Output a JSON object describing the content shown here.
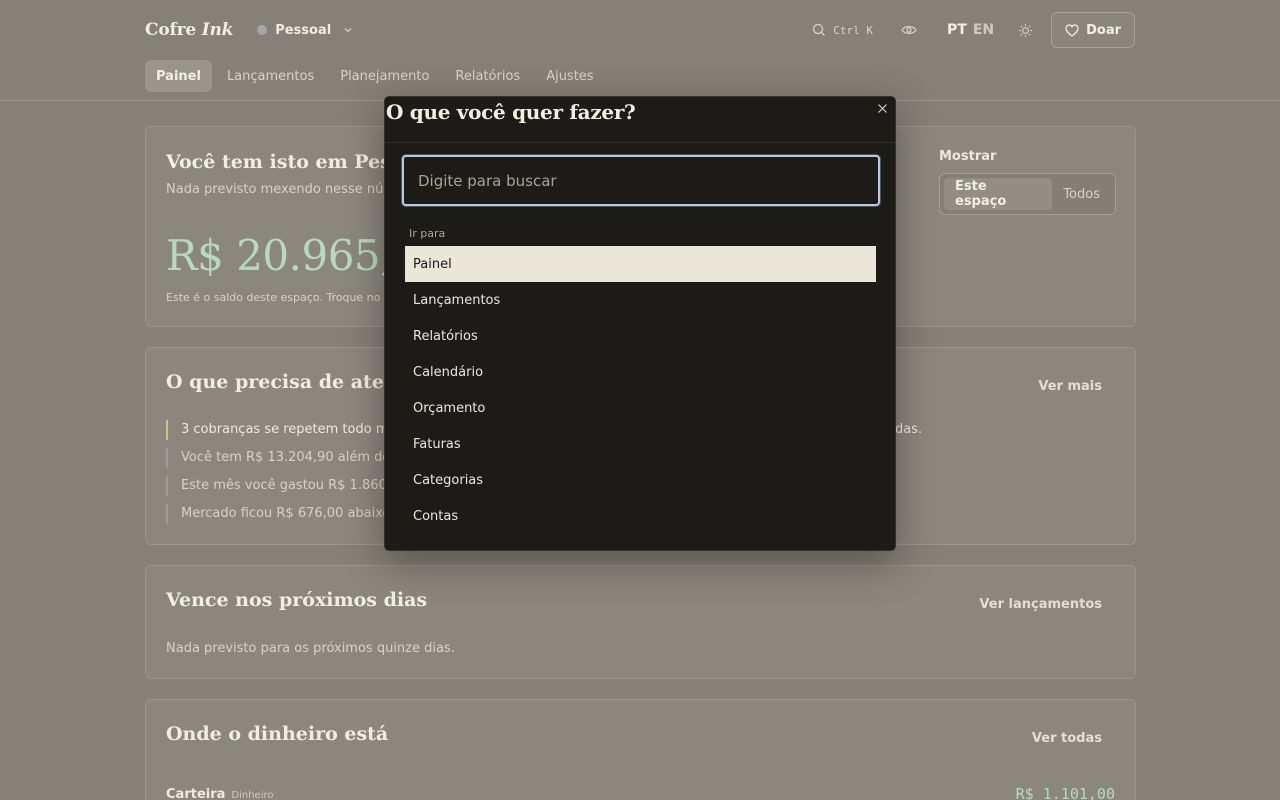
{
  "header": {
    "brand": "Cofre",
    "brand_italic": "Ink",
    "space": "Pessoal",
    "search_shortcut": "Ctrl K",
    "lang_active": "PT",
    "lang_other": "EN",
    "donate_label": "Doar"
  },
  "nav": {
    "items": [
      "Painel",
      "Lançamentos",
      "Planejamento",
      "Relatórios",
      "Ajustes"
    ],
    "active": "Painel"
  },
  "balance_card": {
    "title": "Você tem isto em Pessoal",
    "subtitle": "Nada previsto mexendo nesse número",
    "amount": "R$ 20.965,",
    "note": "Este é o saldo deste espaço. Troque no to",
    "show_label": "Mostrar",
    "toggle_options": [
      "Este espaço",
      "Todos"
    ],
    "toggle_selected": "Este espaço"
  },
  "attention_card": {
    "title": "O que precisa de atenção",
    "link": "Ver mais",
    "items": [
      "3 cobranças se repetem todo mê",
      "Você tem R$ 13.204,90 além dos",
      "Este mês você gastou R$ 1.860,6",
      "Mercado ficou R$ 676,00 abaixo"
    ],
    "trailing_text": "odas."
  },
  "upcoming_card": {
    "title": "Vence nos próximos dias",
    "link": "Ver lançamentos",
    "empty_text": "Nada previsto para os próximos quinze dias."
  },
  "money_card": {
    "title": "Onde o dinheiro está",
    "link": "Ver todas",
    "account_name": "Carteira",
    "account_type": "Dinheiro",
    "account_value": "R$ 1.101,00"
  },
  "palette": {
    "title": "O que você quer fazer?",
    "search_placeholder": "Digite para buscar",
    "group_label": "Ir para",
    "items": [
      "Painel",
      "Lançamentos",
      "Relatórios",
      "Calendário",
      "Orçamento",
      "Faturas",
      "Categorias",
      "Contas"
    ],
    "selected": "Painel"
  },
  "colors": {
    "backdrop": "#858178",
    "palette_bg": "#1d1b17",
    "selected_item_bg": "#ece6d8",
    "money_green": "#b6d9bf",
    "attention_accent": "#d7c07a"
  },
  "icons": {
    "search": "search-icon",
    "eye": "eye-icon",
    "sun": "sun-icon",
    "heart": "heart-icon",
    "chevron": "chevron-down-icon",
    "close": "close-icon"
  }
}
